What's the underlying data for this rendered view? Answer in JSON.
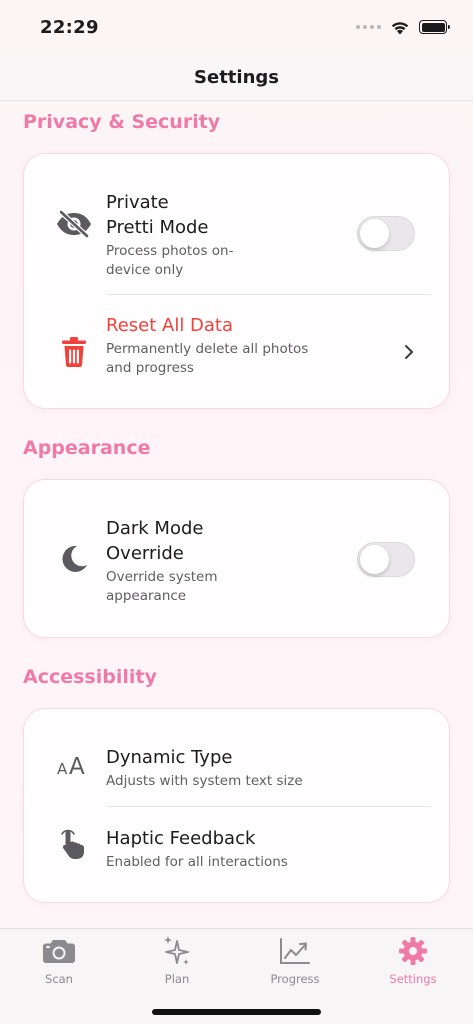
{
  "status_bar": {
    "time": "22:29"
  },
  "nav": {
    "title": "Settings"
  },
  "sections": {
    "privacy": {
      "title": "Privacy & Security",
      "private_mode": {
        "title_line1": "Private",
        "title_line2": "Pretti Mode",
        "sub_line1": "Process photos on-",
        "sub_line2": "device only",
        "enabled": false
      },
      "reset": {
        "title": "Reset All Data",
        "sub_line1": "Permanently delete all photos",
        "sub_line2": "and progress"
      }
    },
    "appearance": {
      "title": "Appearance",
      "dark_mode": {
        "title_line1": "Dark Mode",
        "title_line2": "Override",
        "sub_line1": "Override system",
        "sub_line2": "appearance",
        "enabled": false
      }
    },
    "accessibility": {
      "title": "Accessibility",
      "dynamic_type": {
        "title": "Dynamic Type",
        "sub": "Adjusts with system text size"
      },
      "haptic": {
        "title": "Haptic Feedback",
        "sub": "Enabled for all interactions"
      }
    }
  },
  "tab_bar": {
    "scan": "Scan",
    "plan": "Plan",
    "progress": "Progress",
    "settings": "Settings",
    "active": "settings"
  },
  "colors": {
    "accent": "#f07aa6",
    "destructive": "#f0413a",
    "icon_gray": "#5a5a5f"
  }
}
